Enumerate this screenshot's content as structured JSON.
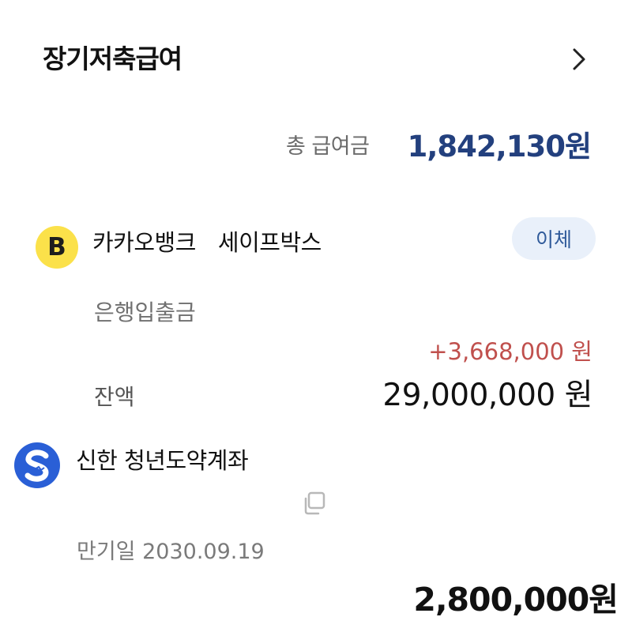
{
  "section": {
    "title": "장기저축급여",
    "chevron_icon": "chevron-right-icon"
  },
  "total": {
    "label": "총 급여금",
    "value": "1,842,130원",
    "value_color": "#23407e"
  },
  "kakaobank": {
    "logo_letter": "B",
    "logo_color": "#fbe14a",
    "bank_name": "카카오뱅크",
    "account_name": "세이프박스",
    "transfer_label": "이체",
    "transaction_label": "은행입출금",
    "delta": "+3,668,000 원",
    "delta_color": "#c0504d",
    "balance_label": "잔액",
    "balance_value": "29,000,000 원"
  },
  "shinhan": {
    "logo_icon": "shinhan-logo-icon",
    "logo_color": "#2a5fd6",
    "account_name": "신한 청년도약계좌",
    "copy_icon": "copy-icon",
    "maturity_label": "만기일 2030.09.19",
    "amount": "2,800,000원"
  }
}
